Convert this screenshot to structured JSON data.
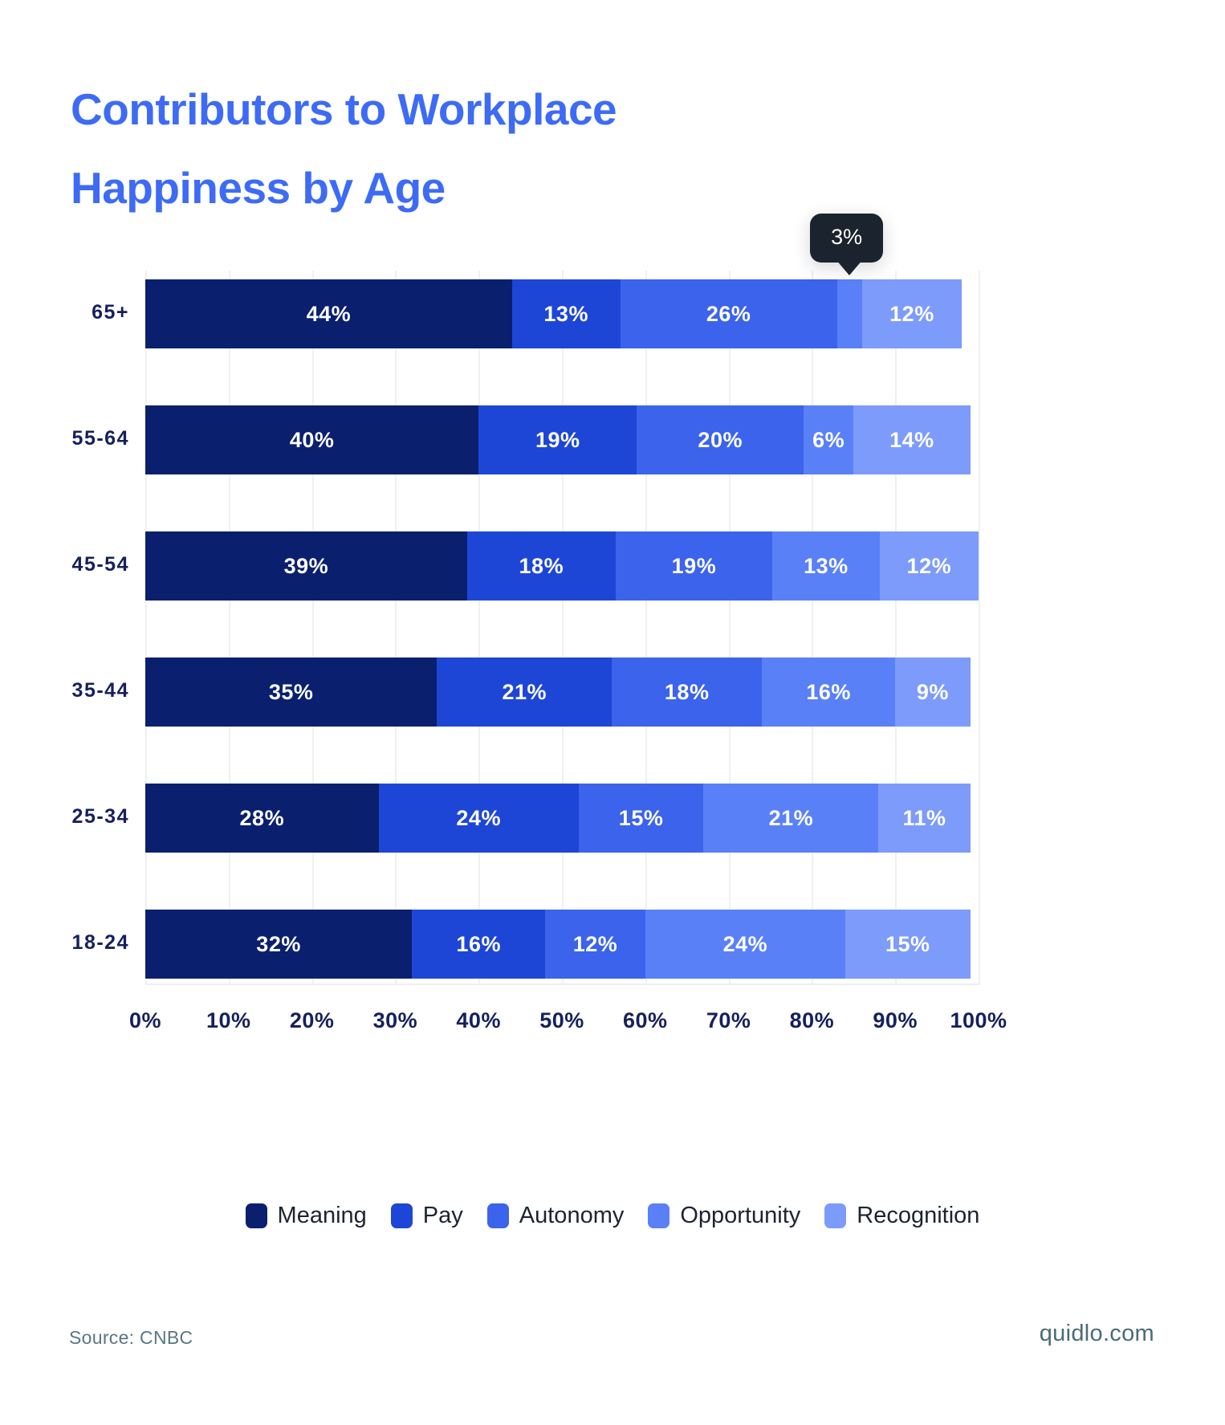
{
  "title": {
    "line1": "Contributors to Workplace",
    "line2": "Happiness by Age",
    "color": "#3d6bf5"
  },
  "tooltip": {
    "value": "3%",
    "background": "#1b232e",
    "text_color": "#ffffff"
  },
  "footer": {
    "source": "Source: CNBC",
    "brand": "quidlo.com"
  },
  "chart_data": {
    "type": "bar",
    "orientation": "horizontal",
    "stacked": true,
    "normalized_percent": true,
    "title": "Contributors to Workplace Happiness by Age",
    "xlabel": "",
    "ylabel": "",
    "xlim": [
      0,
      100
    ],
    "grid": true,
    "legend_position": "bottom",
    "categories": [
      "65+",
      "55-64",
      "45-54",
      "35-44",
      "25-34",
      "18-24"
    ],
    "category_order_top_to_bottom": [
      "65+",
      "55-64",
      "45-54",
      "35-44",
      "25-34",
      "18-24"
    ],
    "tick_labels": [
      "0%",
      "10%",
      "20%",
      "30%",
      "40%",
      "50%",
      "60%",
      "70%",
      "80%",
      "90%",
      "100%"
    ],
    "tick_values": [
      0,
      10,
      20,
      30,
      40,
      50,
      60,
      70,
      80,
      90,
      100
    ],
    "series": [
      {
        "name": "Meaning",
        "color": "#0a1f6e",
        "values": [
          44,
          40,
          39,
          35,
          28,
          32
        ],
        "labels": [
          "44%",
          "40%",
          "39%",
          "35%",
          "28%",
          "32%"
        ]
      },
      {
        "name": "Pay",
        "color": "#1e46d6",
        "values": [
          13,
          19,
          18,
          21,
          24,
          16
        ],
        "labels": [
          "13%",
          "19%",
          "18%",
          "21%",
          "24%",
          "16%"
        ]
      },
      {
        "name": "Autonomy",
        "color": "#3b63ec",
        "values": [
          26,
          20,
          19,
          18,
          15,
          12
        ],
        "labels": [
          "26%",
          "20%",
          "19%",
          "18%",
          "15%",
          "12%"
        ]
      },
      {
        "name": "Opportunity",
        "color": "#5a80f8",
        "values": [
          3,
          6,
          13,
          16,
          21,
          24
        ],
        "labels": [
          "3%",
          "6%",
          "13%",
          "16%",
          "21%",
          "24%"
        ]
      },
      {
        "name": "Recognition",
        "color": "#7d9bfb",
        "values": [
          12,
          14,
          12,
          9,
          11,
          15
        ],
        "labels": [
          "12%",
          "14%",
          "12%",
          "9%",
          "11%",
          "15%"
        ]
      }
    ],
    "hidden_labels": [
      {
        "category": "65+",
        "series": "Opportunity",
        "reason": "segment too narrow, shown in tooltip"
      }
    ],
    "tooltip_annotation": {
      "category": "65+",
      "series": "Opportunity",
      "value": 3,
      "label": "3%"
    }
  }
}
